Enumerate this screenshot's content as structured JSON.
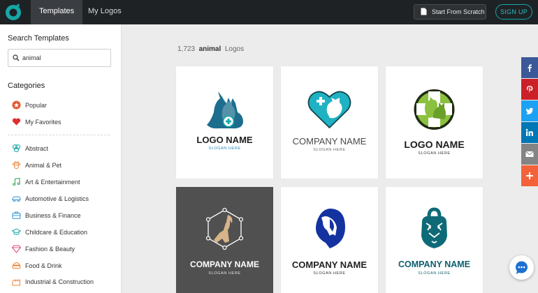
{
  "nav": {
    "templates": "Templates",
    "my_logos": "My Logos",
    "start_from_scratch": "Start From Scratch",
    "sign_up": "SIGN UP"
  },
  "sidebar": {
    "search_heading": "Search Templates",
    "search_value": "animal",
    "categories_heading": "Categories",
    "top_items": [
      {
        "label": "Popular",
        "icon": "star-badge-icon"
      },
      {
        "label": "My Favorites",
        "icon": "heart-icon"
      }
    ],
    "items": [
      {
        "label": "Abstract",
        "icon": "abstract-icon"
      },
      {
        "label": "Animal & Pet",
        "icon": "paw-icon"
      },
      {
        "label": "Art & Entertainment",
        "icon": "music-note-icon"
      },
      {
        "label": "Automotive & Logistics",
        "icon": "car-icon"
      },
      {
        "label": "Business & Finance",
        "icon": "briefcase-icon"
      },
      {
        "label": "Childcare & Education",
        "icon": "graduation-cap-icon"
      },
      {
        "label": "Fashion & Beauty",
        "icon": "diamond-icon"
      },
      {
        "label": "Food & Drink",
        "icon": "food-icon"
      },
      {
        "label": "Industrial & Construction",
        "icon": "factory-icon"
      }
    ]
  },
  "results": {
    "count": "1,723",
    "query": "animal",
    "suffix": "Logos"
  },
  "cards": [
    {
      "name": "LOGO NAME",
      "slogan": "SLOGAN HERE",
      "art": "cat-dog-vet-logo"
    },
    {
      "name": "COMPANY NAME",
      "slogan": "SLOGAN HERE",
      "art": "heart-cross-pets-logo"
    },
    {
      "name": "LOGO NAME",
      "slogan": "SLOGAN HERE",
      "art": "green-cross-pets-logo"
    },
    {
      "name": "COMPANY NAME",
      "slogan": "SLOGAN HERE",
      "art": "goat-hexagon-logo"
    },
    {
      "name": "COMPANY NAME",
      "slogan": "SLOGAN HERE",
      "art": "blue-goat-logo"
    },
    {
      "name": "COMPANY NAME",
      "slogan": "SLOGAN HERE",
      "art": "tiger-kettlebell-logo"
    }
  ],
  "social": [
    {
      "network": "facebook",
      "icon": "facebook-icon",
      "color": "#3b5998"
    },
    {
      "network": "pinterest",
      "icon": "pinterest-icon",
      "color": "#cb2027"
    },
    {
      "network": "twitter",
      "icon": "twitter-icon",
      "color": "#1da1f2"
    },
    {
      "network": "linkedin",
      "icon": "linkedin-icon",
      "color": "#0077b5"
    },
    {
      "network": "email",
      "icon": "email-icon",
      "color": "#848484"
    },
    {
      "network": "more",
      "icon": "plus-icon",
      "color": "#f4623a"
    }
  ],
  "colors": {
    "brand_teal": "#17a7a7",
    "topbar": "#1f2225",
    "signup_accent": "#27c0c4"
  }
}
